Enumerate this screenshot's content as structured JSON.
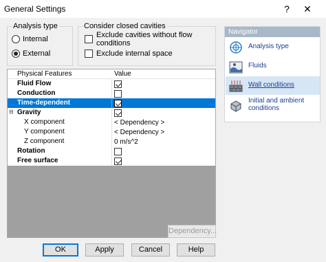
{
  "window": {
    "title": "General Settings",
    "help_glyph": "?",
    "close_glyph": "✕"
  },
  "analysis_type": {
    "legend": "Analysis type",
    "options": [
      {
        "label": "Internal",
        "selected": false
      },
      {
        "label": "External",
        "selected": true
      }
    ]
  },
  "closed_cavities": {
    "legend": "Consider closed cavities",
    "options": [
      {
        "label": "Exclude cavities without flow conditions",
        "checked": false
      },
      {
        "label": "Exclude internal space",
        "checked": false
      }
    ]
  },
  "grid": {
    "headers": {
      "feature": "Physical Features",
      "value": "Value"
    },
    "rows": [
      {
        "label": "Fluid Flow",
        "bold": true,
        "checkbox": true,
        "checked": true,
        "value": ""
      },
      {
        "label": "Conduction",
        "bold": true,
        "checkbox": true,
        "checked": false,
        "value": ""
      },
      {
        "label": "Time-dependent",
        "bold": true,
        "checkbox": true,
        "checked": true,
        "value": "",
        "selected": true
      },
      {
        "label": "Gravity",
        "bold": true,
        "checkbox": true,
        "checked": true,
        "value": "",
        "expander": "⊟"
      },
      {
        "label": "X component",
        "bold": false,
        "checkbox": false,
        "value": "< Dependency >"
      },
      {
        "label": "Y component",
        "bold": false,
        "checkbox": false,
        "value": "< Dependency >"
      },
      {
        "label": "Z component",
        "bold": false,
        "checkbox": false,
        "value": "0 m/s^2"
      },
      {
        "label": "Rotation",
        "bold": true,
        "checkbox": true,
        "checked": false,
        "value": ""
      },
      {
        "label": "Free surface",
        "bold": true,
        "checkbox": true,
        "checked": true,
        "value": ""
      }
    ]
  },
  "navigator": {
    "title": "Navigator",
    "items": [
      {
        "label": "Analysis type",
        "icon": "analysis-type-icon",
        "selected": false
      },
      {
        "label": "Fluids",
        "icon": "fluids-icon",
        "selected": false
      },
      {
        "label": "Wall conditions",
        "icon": "wall-conditions-icon",
        "selected": true
      },
      {
        "label": "Initial and ambient conditions",
        "icon": "initial-conditions-icon",
        "selected": false
      }
    ]
  },
  "buttons": {
    "dependency": "Dependency...",
    "ok": "OK",
    "apply": "Apply",
    "cancel": "Cancel",
    "help": "Help"
  },
  "colors": {
    "selection": "#0078d7",
    "navigator_header": "#a8b8c8",
    "navigator_selected": "#d7e6f5",
    "link_text": "#1a3e8c"
  }
}
